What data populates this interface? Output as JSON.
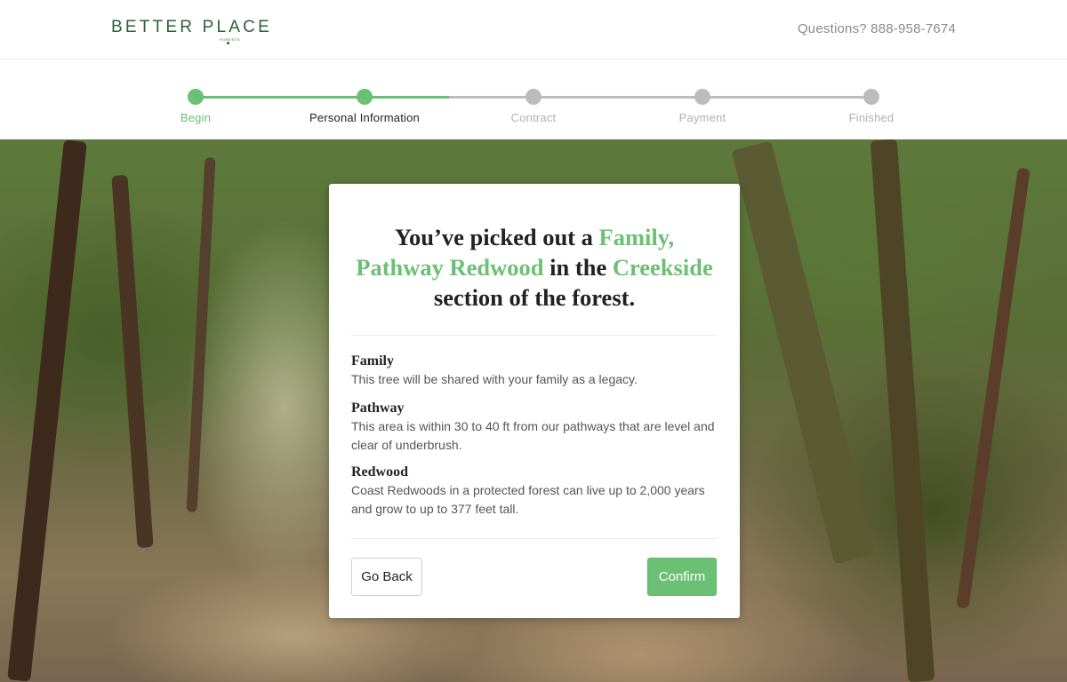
{
  "header": {
    "logo_text": "BETTER PLACE",
    "logo_subtext": "FORESTS",
    "phone_text": "Questions? 888-958-7674"
  },
  "progress": {
    "fraction_complete": 0.375,
    "steps": [
      {
        "label": "Begin",
        "state": "done"
      },
      {
        "label": "Personal Information",
        "state": "current"
      },
      {
        "label": "Contract",
        "state": "upcoming"
      },
      {
        "label": "Payment",
        "state": "upcoming"
      },
      {
        "label": "Finished",
        "state": "upcoming"
      }
    ],
    "colors": {
      "active": "#6cc073",
      "inactive": "#bcbcbc"
    }
  },
  "hero": {
    "background": "forest-photo"
  },
  "card": {
    "headline": {
      "p1": "You’ve picked out a ",
      "h1": "Family, Pathway Redwood",
      "p2": " in the ",
      "h2": "Creekside",
      "p3": " section of the forest."
    },
    "features": [
      {
        "title": "Family",
        "description": "This tree will be shared with your family as a legacy."
      },
      {
        "title": "Pathway",
        "description": "This area is within 30 to 40 ft from our pathways that are level and clear of underbrush."
      },
      {
        "title": "Redwood",
        "description": "Coast Redwoods in a protected forest can live up to 2,000 years and grow to up to 377 feet tall."
      }
    ],
    "back_label": "Go Back",
    "confirm_label": "Confirm"
  },
  "colors": {
    "accent": "#6cc073",
    "brand": "#2f5e3a"
  }
}
